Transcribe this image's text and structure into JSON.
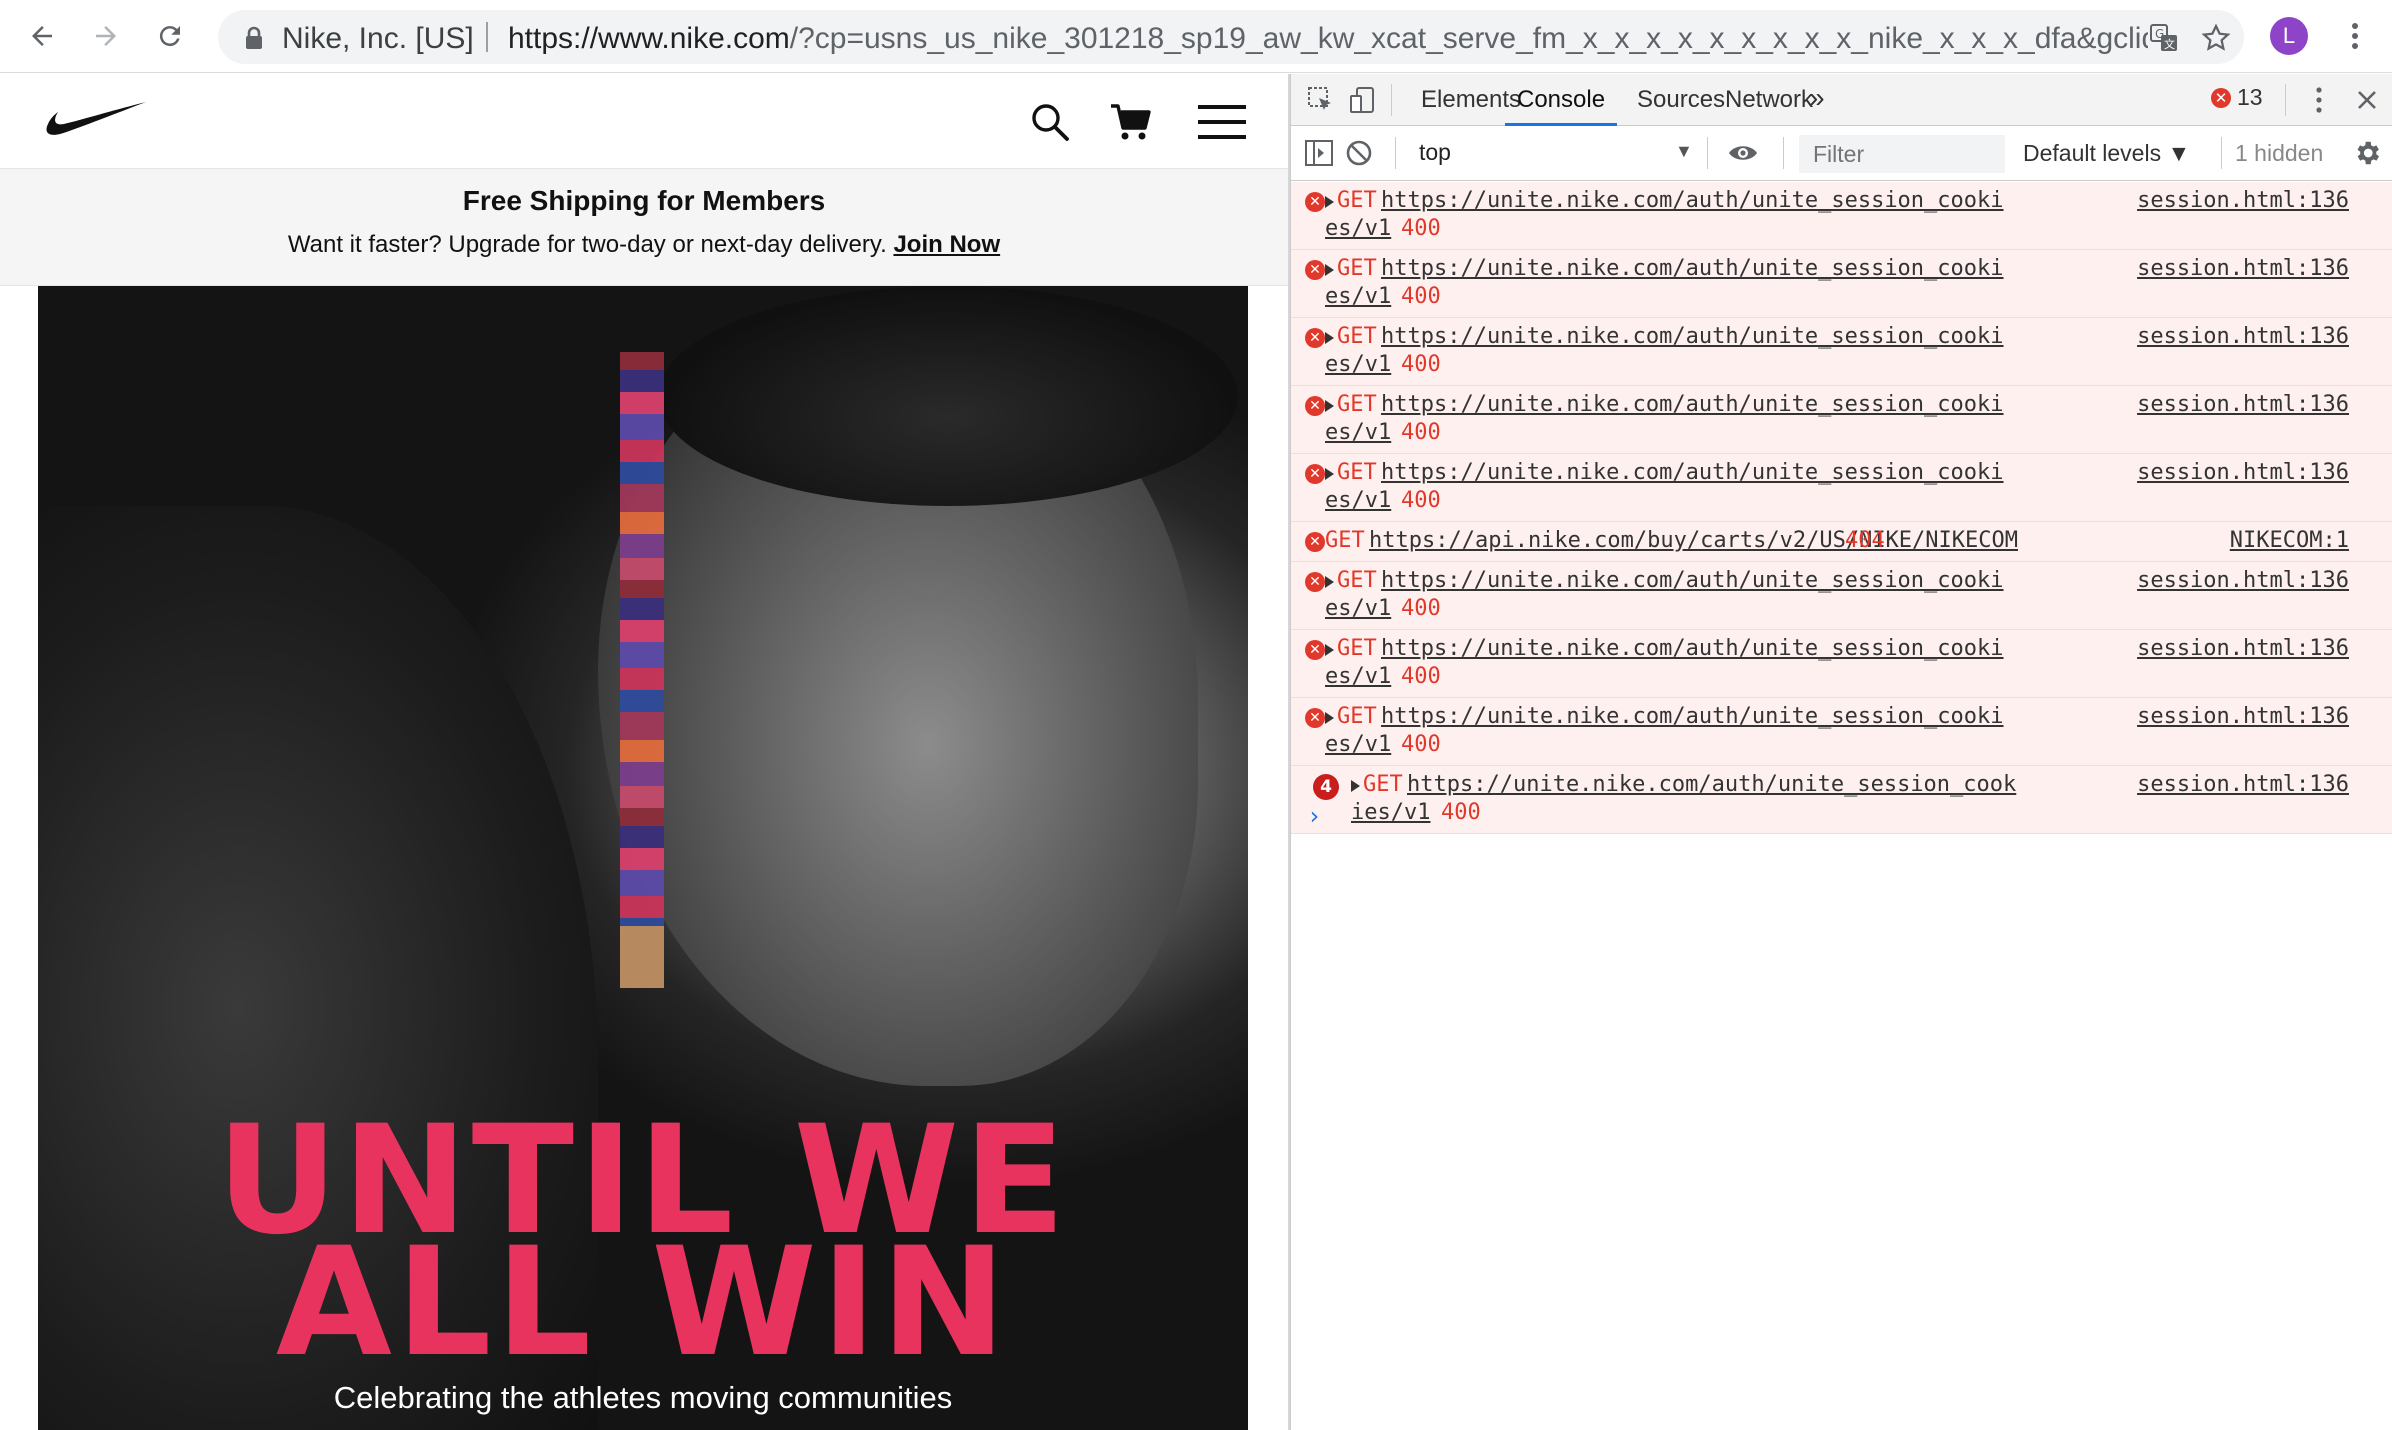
{
  "browser": {
    "site_identity": "Nike, Inc. [US]",
    "url_host": "https://www.nike.com",
    "url_rest": "/?cp=usns_us_nike_301218_sp19_aw_kw_xcat_serve_fm_x_x_x_x_x_x_x_x_x_nike_x_x_x_dfa&gclid=...",
    "avatar_letter": "L",
    "icons": [
      "back-icon",
      "forward-icon",
      "reload-icon",
      "lock-icon",
      "translate-icon",
      "star-icon",
      "kebab-menu-icon"
    ]
  },
  "nike": {
    "header_icons": [
      "nike-swoosh-logo",
      "search-icon",
      "cart-icon",
      "hamburger-menu-icon"
    ],
    "promo": {
      "title": "Free Shipping for Members",
      "subtitle": "Want it faster? Upgrade for two-day or next-day delivery.",
      "link": "Join Now"
    },
    "hero": {
      "headline_line1": "UNTIL WE",
      "headline_line2": "ALL WIN",
      "caption": "Celebrating the athletes moving communities",
      "accent_color": "#e8335e"
    }
  },
  "devtools": {
    "tabs": [
      "Elements",
      "Console",
      "Sources",
      "Network"
    ],
    "active_tab": "Console",
    "more_tabs": "»",
    "error_count": "13",
    "context": "top",
    "filter_placeholder": "Filter",
    "levels": "Default levels ▼",
    "hidden": "1 hidden",
    "messages": [
      {
        "method": "GET",
        "url_a": "https://unite.nike.com/auth/unite_session_cooki",
        "url_b": "es/v1",
        "status": "400",
        "source": "session.html:136",
        "count": ""
      },
      {
        "method": "GET",
        "url_a": "https://unite.nike.com/auth/unite_session_cooki",
        "url_b": "es/v1",
        "status": "400",
        "source": "session.html:136",
        "count": ""
      },
      {
        "method": "GET",
        "url_a": "https://unite.nike.com/auth/unite_session_cooki",
        "url_b": "es/v1",
        "status": "400",
        "source": "session.html:136",
        "count": ""
      },
      {
        "method": "GET",
        "url_a": "https://unite.nike.com/auth/unite_session_cooki",
        "url_b": "es/v1",
        "status": "400",
        "source": "session.html:136",
        "count": ""
      },
      {
        "method": "GET",
        "url_a": "https://unite.nike.com/auth/unite_session_cooki",
        "url_b": "es/v1",
        "status": "400",
        "source": "session.html:136",
        "count": ""
      },
      {
        "method": "GET",
        "url_a": "https://api.nike.com/buy/carts/v2/US/NIKE/NIKECOM",
        "url_b": "",
        "status": "404",
        "source": "NIKECOM:1",
        "count": ""
      },
      {
        "method": "GET",
        "url_a": "https://unite.nike.com/auth/unite_session_cooki",
        "url_b": "es/v1",
        "status": "400",
        "source": "session.html:136",
        "count": ""
      },
      {
        "method": "GET",
        "url_a": "https://unite.nike.com/auth/unite_session_cooki",
        "url_b": "es/v1",
        "status": "400",
        "source": "session.html:136",
        "count": ""
      },
      {
        "method": "GET",
        "url_a": "https://unite.nike.com/auth/unite_session_cooki",
        "url_b": "es/v1",
        "status": "400",
        "source": "session.html:136",
        "count": ""
      },
      {
        "method": "GET",
        "url_a": "https://unite.nike.com/auth/unite_session_cook",
        "url_b": "ies/v1",
        "status": "400",
        "source": "session.html:136",
        "count": "4"
      }
    ],
    "prompt": "›",
    "error_color": "#e0392b"
  }
}
